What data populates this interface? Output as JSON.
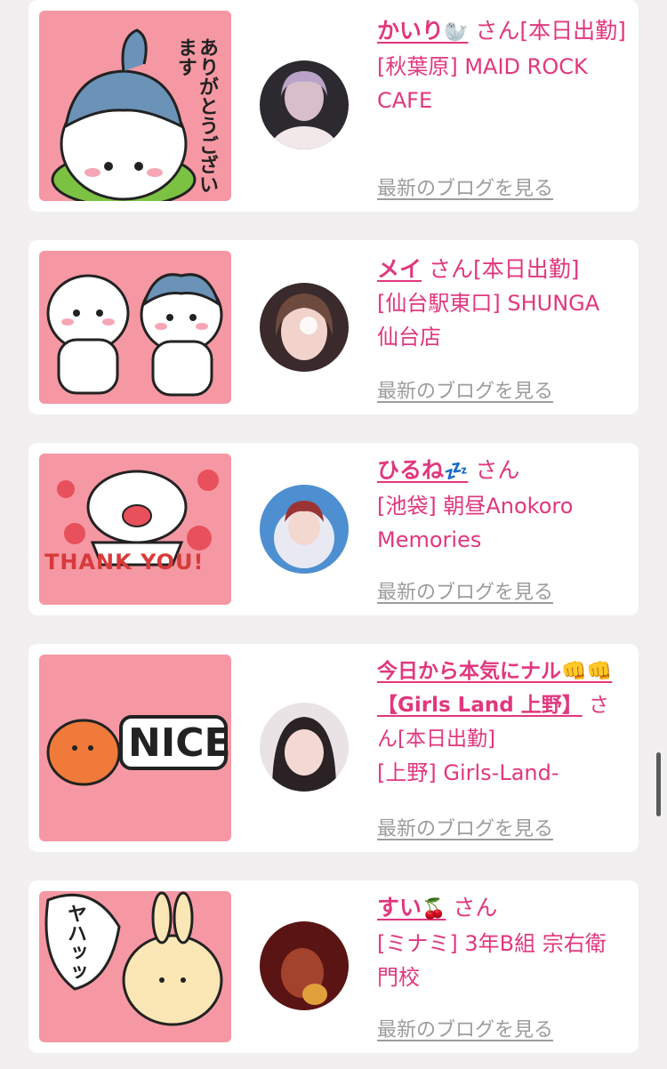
{
  "blog_link_label": "最新のブログを見る",
  "colors": {
    "accent": "#e1377e",
    "thumb_bg": "#f598a3",
    "page_bg": "#f1eff0"
  },
  "entries": [
    {
      "name": "かいり",
      "name_emoji": "🦭",
      "suffix": "さん[本日出勤]",
      "shop": "[秋葉原] MAID ROCK CAFE",
      "sticker_text": "ありがとうございます",
      "sticker_icon": "chiikawa-hachiware-thanks-sticker"
    },
    {
      "name": "メイ",
      "name_emoji": "",
      "suffix": "さん[本日出勤]",
      "shop": "[仙台駅東口] SHUNGA 仙台店",
      "sticker_text": "",
      "sticker_icon": "chiikawa-pair-sticker"
    },
    {
      "name": "ひるね",
      "name_emoji": "💤",
      "suffix": "さん",
      "shop": "[池袋] 朝昼Anokoro Memories",
      "sticker_text": "THANK YOU!",
      "sticker_icon": "chiikawa-thank-you-sticker"
    },
    {
      "name": "今日から本気にナル👊👊【Girls Land 上野】",
      "name_emoji": "",
      "suffix": "さん[本日出勤]",
      "shop": "[上野] Girls-Land-",
      "sticker_text": "NICE",
      "sticker_icon": "orange-creature-nice-sticker"
    },
    {
      "name": "すい",
      "name_emoji": "🍒",
      "suffix": "さん",
      "shop": "[ミナミ] 3年B組 宗右衛門校",
      "sticker_text": "ヤハッッ",
      "sticker_icon": "usagi-yaha-sticker"
    }
  ]
}
